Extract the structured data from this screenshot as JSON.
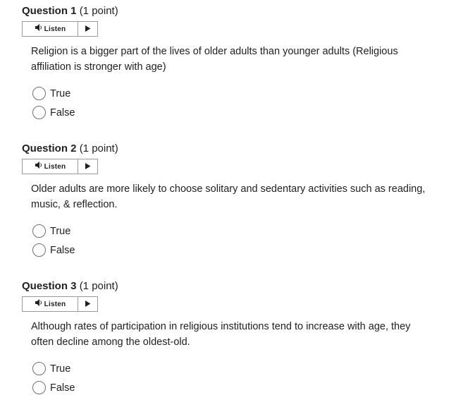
{
  "listen_label": "Listen",
  "questions": [
    {
      "number": "Question 1",
      "points": "(1 point)",
      "text": "Religion is a bigger part of the lives of older adults than younger adults (Religious affiliation is stronger with age)",
      "options": [
        "True",
        "False"
      ]
    },
    {
      "number": "Question 2",
      "points": "(1 point)",
      "text": "Older adults are more likely to choose solitary and sedentary activities such as reading, music, & reflection.",
      "options": [
        "True",
        "False"
      ]
    },
    {
      "number": "Question 3",
      "points": "(1 point)",
      "text": "Although rates of participation in religious institutions tend to increase with age, they often decline among the oldest-old.",
      "options": [
        "True",
        "False"
      ]
    }
  ]
}
